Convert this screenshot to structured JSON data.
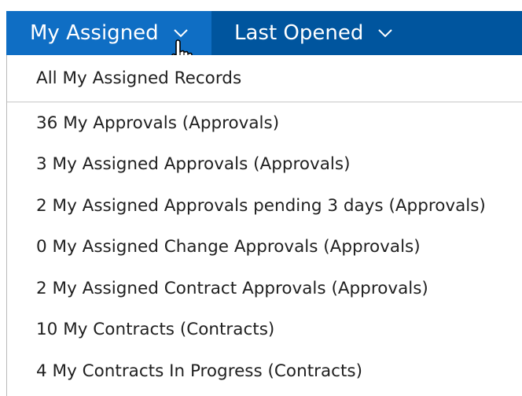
{
  "tabs": {
    "my_assigned": "My Assigned",
    "last_opened": "Last Opened"
  },
  "menu": {
    "header": "All My Assigned Records",
    "items": [
      "36 My Approvals (Approvals)",
      "3 My Assigned Approvals (Approvals)",
      "2 My Assigned Approvals pending 3 days (Approvals)",
      "0 My Assigned Change Approvals (Approvals)",
      "2 My Assigned Contract Approvals (Approvals)",
      "10 My Contracts (Contracts)",
      "4 My Contracts In Progress (Contracts)"
    ]
  },
  "icons": {
    "tab_dropdown": "chevron-down-icon",
    "pointer": "hand-pointer-cursor-icon"
  },
  "colors": {
    "nav_bar": "#00559e",
    "active_tab": "#0f6ec4",
    "text": "#1f1f1f"
  }
}
